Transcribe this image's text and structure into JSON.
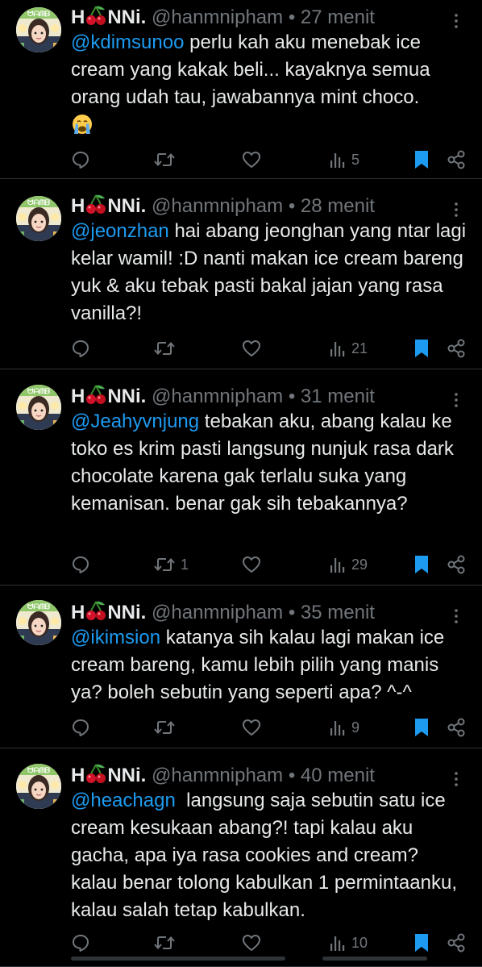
{
  "colors": {
    "accent": "#1d9bf0",
    "muted": "#71767b",
    "text": "#e7e9ea",
    "divider": "#2f3336"
  },
  "tweets": [
    {
      "display_name_pre": "H",
      "display_name_post": "NNi.",
      "handle": "@hanmnipham",
      "sep": "•",
      "time": "27 menit",
      "mention": "@kdimsunoo",
      "text": " perlu kah aku menebak ice cream yang kakak beli... kayaknya semua orang udah tau, jawabannya mint choco.",
      "emoji": "crying-face",
      "retweets": "",
      "views": "5",
      "bookmarked": true
    },
    {
      "display_name_pre": "H",
      "display_name_post": "NNi.",
      "handle": "@hanmnipham",
      "sep": "•",
      "time": "28 menit",
      "mention": "@jeonzhan",
      "text": " hai abang jeonghan yang ntar lagi kelar wamil! :D nanti makan ice cream bareng yuk & aku tebak pasti bakal jajan yang rasa vanilla?!",
      "emoji": "",
      "retweets": "",
      "views": "21",
      "bookmarked": true
    },
    {
      "display_name_pre": "H",
      "display_name_post": "NNi.",
      "handle": "@hanmnipham",
      "sep": "•",
      "time": "31 menit",
      "mention": "@Jeahyvnjung",
      "text": " tebakan aku, abang kalau ke toko es krim pasti langsung nunjuk rasa dark chocolate karena gak terlalu suka yang kemanisan. benar gak sih tebakannya?",
      "emoji": "",
      "retweets": "1",
      "views": "29",
      "bookmarked": true
    },
    {
      "display_name_pre": "H",
      "display_name_post": "NNi.",
      "handle": "@hanmnipham",
      "sep": "•",
      "time": "35 menit",
      "mention": "@ikimsion",
      "text": " katanya sih kalau lagi makan ice cream bareng, kamu lebih pilih yang manis ya? boleh sebutin yang seperti apa? ^-^",
      "emoji": "",
      "retweets": "",
      "views": "9",
      "bookmarked": true
    },
    {
      "display_name_pre": "H",
      "display_name_post": "NNi.",
      "handle": "@hanmnipham",
      "sep": "•",
      "time": "40 menit",
      "mention": "@heachagn",
      "text": "  langsung saja sebutin satu ice cream kesukaan abang?! tapi kalau aku gacha, apa iya rasa cookies and cream? kalau benar tolong kabulkan 1 permintaanku, kalau salah tetap kabulkan.",
      "emoji": "",
      "retweets": "",
      "views": "10",
      "bookmarked": true
    }
  ]
}
